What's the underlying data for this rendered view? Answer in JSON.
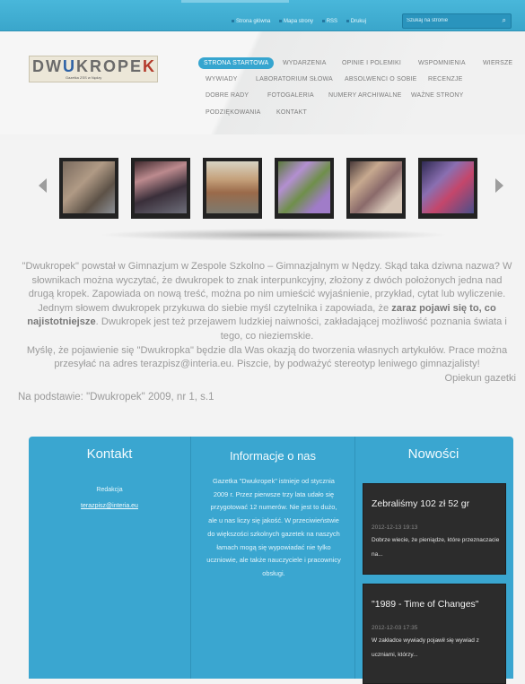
{
  "topbar": {
    "links": [
      "Strona główna",
      "Mapa strony",
      "RSS",
      "Drukuj"
    ],
    "search_placeholder": "Szukaj na stronie",
    "search_icon": "magnifier-icon"
  },
  "logo": {
    "text_part1": "DW",
    "text_part2": "U",
    "text_part3": "KROPE",
    "text_part4": "K",
    "subtitle": "Gazetka ZSS w Nędzy"
  },
  "nav": {
    "items": [
      "STRONA STARTOWA",
      "WYDARZENIA",
      "OPINIE I POLEMIKI",
      "WSPOMNIENIA",
      "WIERSZE",
      "WYWIADY",
      "LABORATORIUM SŁOWA",
      "ABSOLWENCI O SOBIE",
      "RECENZJE",
      "DOBRE RADY",
      "FOTOGALERIA",
      "NUMERY ARCHIWALNE",
      "WAŻNE STRONY",
      "PODZIĘKOWANIA",
      "KONTAKT"
    ],
    "active_index": 0
  },
  "carousel": {
    "prev_icon": "arrow-left-icon",
    "next_icon": "arrow-right-icon",
    "thumbs": [
      "photo-1",
      "photo-2",
      "photo-3",
      "photo-4",
      "photo-5",
      "photo-6",
      "photo-7"
    ]
  },
  "intro": {
    "p1": "\"Dwukropek\" powstał w Gimnazjum w Zespole Szkolno – Gimnazjalnym w Nędzy. Skąd taka dziwna nazwa? W słownikach można wyczytać, że dwukropek to znak interpunkcyjny, złożony z dwóch położonych jedna nad drugą kropek. Zapowiada on nową treść, można po nim umieścić wyjaśnienie, przykład, cytat lub wyliczenie. Jednym słowem dwukropek przykuwa do siebie myśl czytelnika i zapowiada, że",
    "p1_bold": "zaraz pojawi się to, co najistotniejsze",
    "p1_end": ". Dwukropek jest też przejawem ludzkiej naiwności, zakładającej możliwość poznania świata i tego, co nieziemskie.",
    "p2": "Myślę, że pojawienie się \"Dwukropka\" będzie dla Was okazją do tworzenia własnych artykułów. Prace można przesyłać na adres terazpisz@interia.eu. Piszcie, by podważyć stereotyp leniwego gimnazjalisty!",
    "signature": "Opiekun gazetki",
    "source": "Na podstawie: \"Dwukropek\" 2009, nr 1, s.1"
  },
  "footer": {
    "contact": {
      "title": "Kontakt",
      "label": "Redakcja",
      "email": "terazpisz@interia.eu"
    },
    "info": {
      "title": "Informacje o nas",
      "text": "Gazetka \"Dwukropek\" istnieje od stycznia 2009 r. Przez pierwsze trzy lata udało się przygotować 12 numerów. Nie jest to dużo, ale u nas liczy się jakość. W przeciwieństwie do większości szkolnych gazetek na naszych łamach mogą się wypowiadać nie tylko uczniowie, ale także nauczyciele i pracownicy obsługi."
    },
    "news": {
      "title": "Nowości",
      "items": [
        {
          "title": "Zebraliśmy 102 zł 52 gr",
          "date": "2012-12-13 19:13",
          "excerpt": "Dobrze wiecie, że pieniądze, które przeznaczacie na..."
        },
        {
          "title": "\"1989 - Time of Changes\"",
          "date": "2012-12-03 17:35",
          "excerpt": "W zakładce wywiady pojawił się wywiad z uczniami, którzy..."
        }
      ]
    }
  },
  "colors": {
    "accent": "#3aa6d0",
    "nav_active": "#36a5cf",
    "news_bg": "#2c2c2c"
  }
}
